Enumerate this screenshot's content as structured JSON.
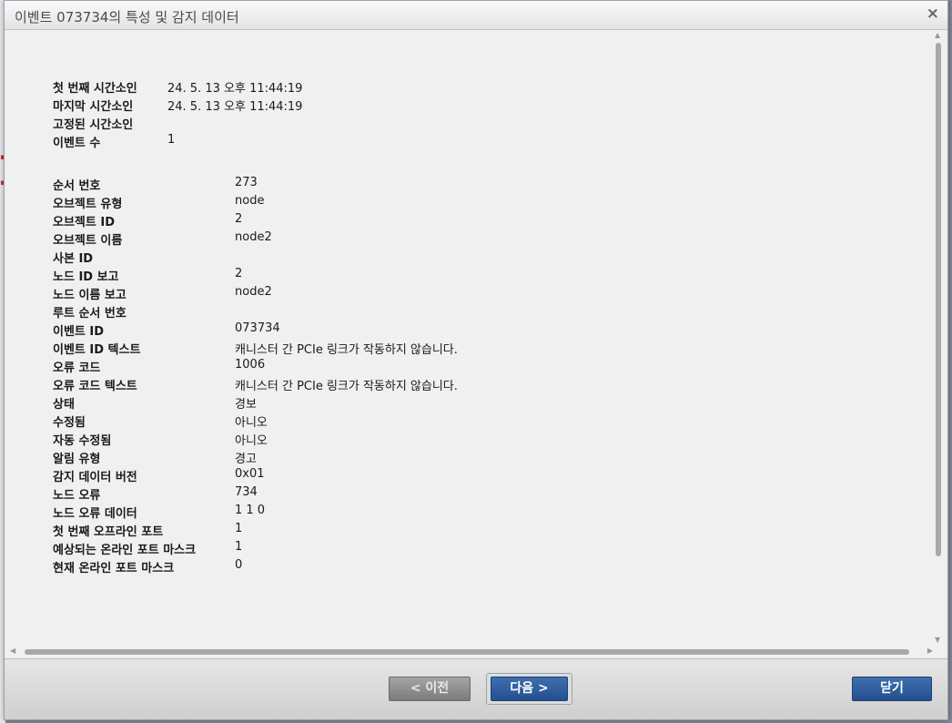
{
  "dialog": {
    "title": "이벤트 073734의 특성 및 감지 데이터",
    "close_glyph": "×"
  },
  "summary": [
    {
      "label": "첫 번째 시간소인",
      "value": "24. 5. 13 오후 11:44:19"
    },
    {
      "label": "마지막 시간소인",
      "value": "24. 5. 13 오후 11:44:19"
    },
    {
      "label": "고정된 시간소인",
      "value": ""
    },
    {
      "label": "이벤트 수",
      "value": "1"
    }
  ],
  "details": [
    {
      "label": "순서 번호",
      "value": "273"
    },
    {
      "label": "오브젝트 유형",
      "value": "node"
    },
    {
      "label": "오브젝트 ID",
      "value": "2"
    },
    {
      "label": "오브젝트 이름",
      "value": "node2"
    },
    {
      "label": "사본 ID",
      "value": ""
    },
    {
      "label": "노드 ID 보고",
      "value": "2"
    },
    {
      "label": "노드 이름 보고",
      "value": "node2"
    },
    {
      "label": "루트 순서 번호",
      "value": ""
    },
    {
      "label": "이벤트 ID",
      "value": "073734"
    },
    {
      "label": "이벤트 ID 텍스트",
      "value": "캐니스터 간 PCIe 링크가 작동하지 않습니다."
    },
    {
      "label": "오류 코드",
      "value": "1006"
    },
    {
      "label": "오류 코드 텍스트",
      "value": "캐니스터 간 PCIe 링크가 작동하지 않습니다."
    },
    {
      "label": "상태",
      "value": "경보"
    },
    {
      "label": "수정됨",
      "value": "아니오"
    },
    {
      "label": "자동 수정됨",
      "value": "아니오"
    },
    {
      "label": "알림 유형",
      "value": "경고"
    },
    {
      "label": "감지 데이터 버전",
      "value": "0x01"
    },
    {
      "label": "노드 오류",
      "value": "734"
    },
    {
      "label": "노드 오류 데이터",
      "value": "1 1 0"
    },
    {
      "label": "첫 번째 오프라인 포트",
      "value": "1"
    },
    {
      "label": "예상되는 온라인 포트 마스크",
      "value": "1"
    },
    {
      "label": "현재 온라인 포트 마스크",
      "value": "0"
    }
  ],
  "footer": {
    "prev_label": "< 이전",
    "next_label": "다음 >",
    "close_label": "닫기"
  },
  "colors": {
    "primary_button": "#2f5d9e",
    "disabled_button": "#8a8a8a"
  }
}
